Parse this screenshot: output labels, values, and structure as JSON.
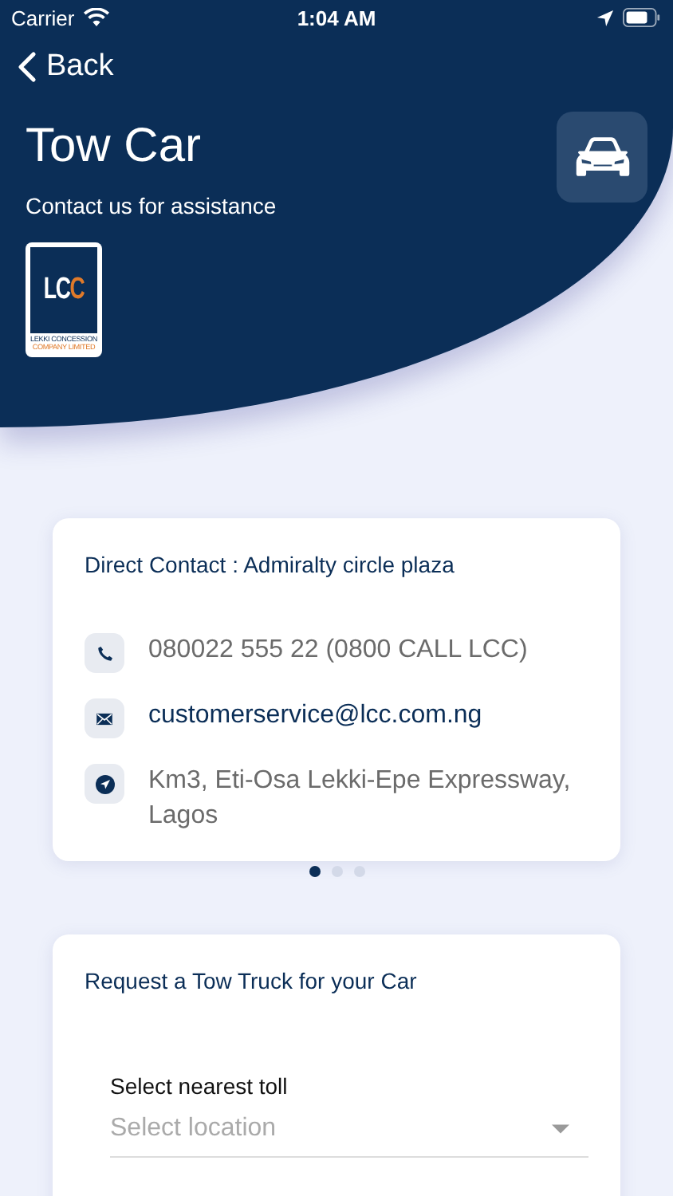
{
  "status_bar": {
    "carrier": "Carrier",
    "time": "1:04 AM"
  },
  "nav": {
    "back": "Back"
  },
  "header": {
    "title": "Tow Car",
    "subtitle": "Contact us for assistance",
    "logo": {
      "mark": "LCC",
      "caption": "LEKKI CONCESSION",
      "caption_2": "COMPANY LIMITED"
    }
  },
  "contact_card": {
    "title": "Direct Contact : Admiralty circle plaza",
    "items": [
      {
        "kind": "phone",
        "text": "080022 555 22 (0800 CALL LCC)"
      },
      {
        "kind": "email",
        "text": "customerservice@lcc.com.ng"
      },
      {
        "kind": "address",
        "text": "Km3, Eti-Osa Lekki-Epe Expressway, Lagos"
      }
    ]
  },
  "pager": [
    {
      "selected": true
    },
    {
      "selected": false
    },
    {
      "selected": false
    }
  ],
  "request_card": {
    "title": "Request a Tow Truck for your Car",
    "field": {
      "label": "Select nearest toll",
      "placeholder": "Select location"
    }
  }
}
